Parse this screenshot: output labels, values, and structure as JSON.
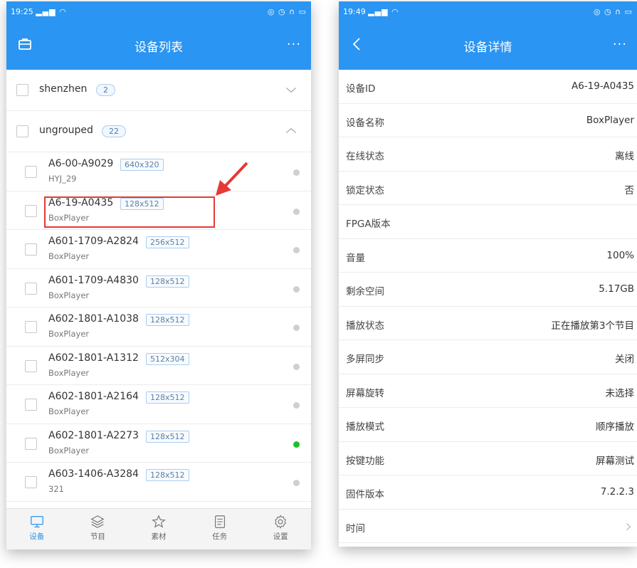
{
  "left": {
    "status": {
      "time": "19:25",
      "signal": "▂▄▆ ◠",
      "right_icons": "◎ ◷ ∩ ▭"
    },
    "title": "设备列表",
    "more": "···",
    "groups": [
      {
        "name": "shenzhen",
        "count": "2",
        "expanded": false
      },
      {
        "name": "ungrouped",
        "count": "22",
        "expanded": true
      }
    ],
    "devices": [
      {
        "id": "A6-00-A9029",
        "res": "640x320",
        "name": "HYJ_29",
        "online": false
      },
      {
        "id": "A6-19-A0435",
        "res": "128x512",
        "name": "BoxPlayer",
        "online": false
      },
      {
        "id": "A601-1709-A2824",
        "res": "256x512",
        "name": "BoxPlayer",
        "online": false
      },
      {
        "id": "A601-1709-A4830",
        "res": "128x512",
        "name": "BoxPlayer",
        "online": false
      },
      {
        "id": "A602-1801-A1038",
        "res": "128x512",
        "name": "BoxPlayer",
        "online": false
      },
      {
        "id": "A602-1801-A1312",
        "res": "512x304",
        "name": "BoxPlayer",
        "online": false
      },
      {
        "id": "A602-1801-A2164",
        "res": "128x512",
        "name": "BoxPlayer",
        "online": false
      },
      {
        "id": "A602-1801-A2273",
        "res": "128x512",
        "name": "BoxPlayer",
        "online": true
      },
      {
        "id": "A603-1406-A3284",
        "res": "128x512",
        "name": "321",
        "online": false
      }
    ],
    "tabs": [
      {
        "label": "设备",
        "icon": "monitor-icon",
        "active": true
      },
      {
        "label": "节目",
        "icon": "layers-icon",
        "active": false
      },
      {
        "label": "素材",
        "icon": "star-icon",
        "active": false
      },
      {
        "label": "任务",
        "icon": "document-icon",
        "active": false
      },
      {
        "label": "设置",
        "icon": "gear-icon",
        "active": false
      }
    ]
  },
  "right": {
    "status": {
      "time": "19:49",
      "signal": "▂▄▆ ◠",
      "right_icons": "◎ ◷ ∩ ▭"
    },
    "title": "设备详情",
    "more": "···",
    "rows": [
      {
        "key": "设备ID",
        "value": "A6-19-A0435"
      },
      {
        "key": "设备名称",
        "value": "BoxPlayer"
      },
      {
        "key": "在线状态",
        "value": "离线"
      },
      {
        "key": "锁定状态",
        "value": "否"
      },
      {
        "key": "FPGA版本",
        "value": ""
      },
      {
        "key": "音量",
        "value": "100%"
      },
      {
        "key": "剩余空间",
        "value": "5.17GB"
      },
      {
        "key": "播放状态",
        "value": "正在播放第3个节目"
      },
      {
        "key": "多屏同步",
        "value": "关闭"
      },
      {
        "key": "屏幕旋转",
        "value": "未选择"
      },
      {
        "key": "播放模式",
        "value": "顺序播放"
      },
      {
        "key": "按键功能",
        "value": "屏幕测试"
      },
      {
        "key": "固件版本",
        "value": "7.2.2.3"
      },
      {
        "key": "时间",
        "value": ""
      }
    ]
  },
  "colors": {
    "accent": "#2a95f2",
    "online": "#1fbf2a",
    "offline": "#cfcfcf",
    "highlight": "#e53935"
  }
}
